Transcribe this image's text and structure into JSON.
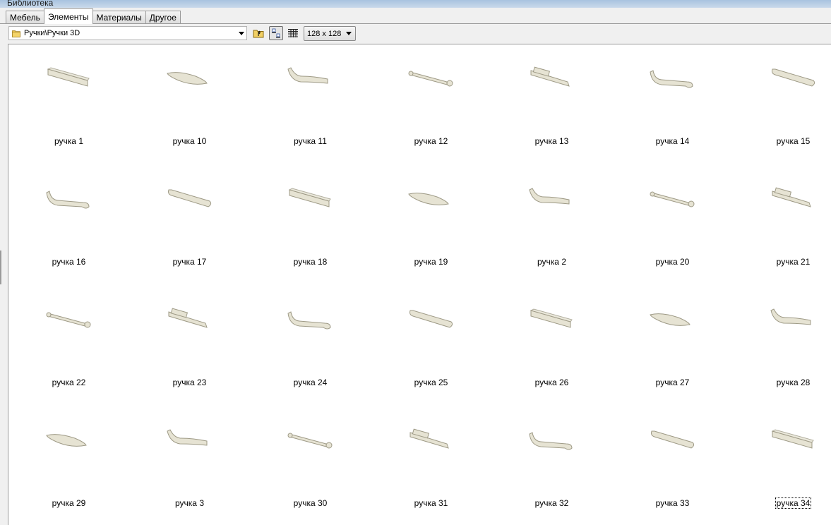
{
  "window": {
    "title": "Библиотека"
  },
  "tabs": [
    {
      "label": "Мебель",
      "active": false
    },
    {
      "label": "Элементы",
      "active": true
    },
    {
      "label": "Материалы",
      "active": false
    },
    {
      "label": "Другое",
      "active": false
    }
  ],
  "toolbar": {
    "path": "Ручки\\Ручки 3D",
    "thumb_size": "128 x 128",
    "icons": [
      "folder-icon",
      "folder-up-icon",
      "large-icons-view-icon",
      "list-view-icon",
      "chevron-down-icon"
    ]
  },
  "colors": {
    "handle_fill": "#e6e3d3",
    "handle_stroke": "#9e9a86",
    "selection_outline": "#000000"
  },
  "items": [
    {
      "label": "ручка 1"
    },
    {
      "label": "ручка 10"
    },
    {
      "label": "ручка 11"
    },
    {
      "label": "ручка 12"
    },
    {
      "label": "ручка 13"
    },
    {
      "label": "ручка 14"
    },
    {
      "label": "ручка 15"
    },
    {
      "label": "ручка 16"
    },
    {
      "label": "ручка 17"
    },
    {
      "label": "ручка 18"
    },
    {
      "label": "ручка 19"
    },
    {
      "label": "ручка 2"
    },
    {
      "label": "ручка 20"
    },
    {
      "label": "ручка 21"
    },
    {
      "label": "ручка 22"
    },
    {
      "label": "ручка 23"
    },
    {
      "label": "ручка 24"
    },
    {
      "label": "ручка 25"
    },
    {
      "label": "ручка 26"
    },
    {
      "label": "ручка 27"
    },
    {
      "label": "ручка 28"
    },
    {
      "label": "ручка 29"
    },
    {
      "label": "ручка 3"
    },
    {
      "label": "ручка 30"
    },
    {
      "label": "ручка 31"
    },
    {
      "label": "ручка 32"
    },
    {
      "label": "ручка 33"
    },
    {
      "label": "ручка 34",
      "focused": true
    }
  ]
}
